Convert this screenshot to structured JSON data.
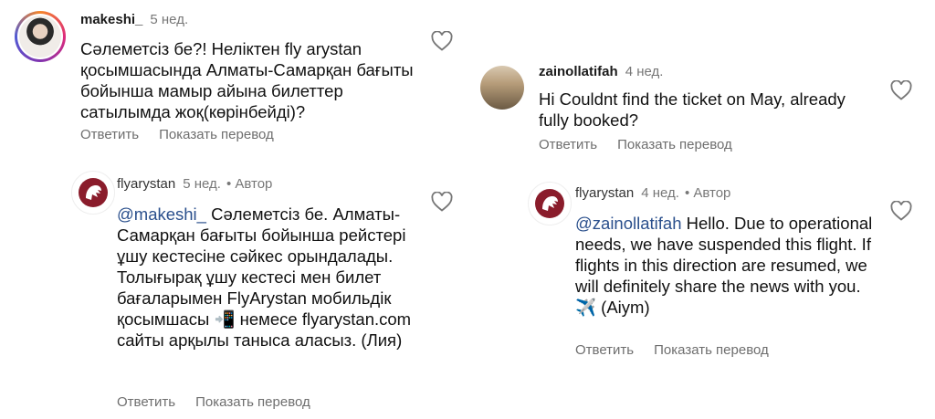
{
  "comments": [
    {
      "username": "makeshi_",
      "time": "5 нед.",
      "text": "Сәлеметсіз бе?! Неліктен fly arystan қосымшасында Алматы-Самарқан бағыты бойынша мамыр айына билеттер сатылымда жоқ(көрінбейді)?",
      "reply_label": "Ответить",
      "translate_label": "Показать перевод",
      "icon": "heart-outline-icon"
    },
    {
      "username": "flyarystan",
      "time": "5 нед.",
      "author_label": "• Автор",
      "mention": "@makeshi_",
      "text": " Сәлеметсіз бе. Алматы-Самарқан бағыты бойынша рейстері ұшу кестесіне сәйкес орындалады. Толығырақ ұшу кестесі мен билет бағаларымен FlyArystan мобильдік қосымшасы 📲 немесе flyarystan.com сайты арқылы таныса аласыз. (Лия)",
      "reply_label": "Ответить",
      "translate_label": "Показать перевод",
      "icon": "heart-outline-icon"
    },
    {
      "username": "zainollatifah",
      "time": "4 нед.",
      "text": "Hi Couldnt find the ticket on May, already fully booked?",
      "reply_label": "Ответить",
      "translate_label": "Показать перевод",
      "icon": "heart-outline-icon"
    },
    {
      "username": "flyarystan",
      "time": "4 нед.",
      "author_label": "• Автор",
      "mention": "@zainollatifah",
      "text": " Hello. Due to operational needs, we have suspended this flight. If flights in this direction are resumed, we will definitely share the news with you.✈️ (Aiym)",
      "reply_label": "Ответить",
      "translate_label": "Показать перевод",
      "icon": "heart-outline-icon"
    }
  ],
  "colors": {
    "mention": "#2a4f8c",
    "brand": "#8a1c2b",
    "secondary_text": "#6e6e6e"
  }
}
